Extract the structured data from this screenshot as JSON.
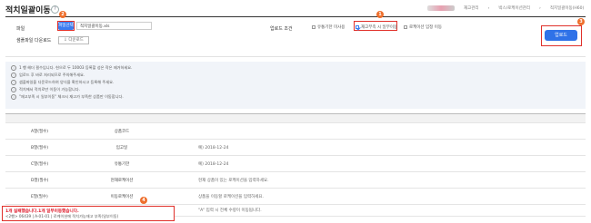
{
  "header": {
    "title": "적치일괄이동",
    "breadcrumbs": [
      "재고관리",
      "박스/로케이션관리",
      "적치일괄이동(H60)"
    ]
  },
  "form": {
    "file_label": "파일",
    "file_select_button": "파일선택",
    "file_name": "적치일괄이동.xls",
    "sample_label": "샘플파일 다운로드",
    "sample_button": "다운로드",
    "upload_condition_label": "업로드 조건",
    "options": [
      {
        "label": "유통기한 미사용",
        "checked": false
      },
      {
        "label": "재고부족 시 일부이동",
        "checked": true
      },
      {
        "label": "로케이션 임정 이동",
        "checked": false
      }
    ],
    "upload_button": "업로드"
  },
  "badges": [
    "1",
    "2",
    "3",
    "4"
  ],
  "notes": [
    "1 행 헤더 필수입니다. 헌으로 두 10003 등록할 성은 작은 제거하세요.",
    "업로드 후 바로 처리되므로 주의해주세요.",
    "샘플파일을 다운로드하여 양식을 확인하시고 등록해 주세요.",
    "적치에서 적치로만 이동이 가능합니다.",
    "\"재고부족 시 일부이동\" 체크시 재고가 부족한 상품만 이동합니다."
  ],
  "table": {
    "rows": [
      {
        "col": "A열(필수)",
        "name": "상품코드",
        "desc": ""
      },
      {
        "col": "B열(필수)",
        "name": "입고일",
        "desc": "예) 2018-12-24"
      },
      {
        "col": "C열(필수)",
        "name": "유통기한",
        "desc": "예) 2018-12-24"
      },
      {
        "col": "D열(필수)",
        "name": "현재로케이션",
        "desc": "현재 상품이 있는 로케이션을 입력하세요."
      },
      {
        "col": "E열(필수)",
        "name": "이동로케이션",
        "desc": "상품을 이동할 로케이션을 입력하세요."
      },
      {
        "col": "F열(필수)",
        "name": "수량",
        "desc": "\"A\" 입력 시 전체 수량이 이동됩니다."
      }
    ]
  },
  "result": {
    "line1": "1개 실패했습니다.1개 일부이동했습니다.",
    "line2": "<2행> 06439 | A-01-01 | 로케이션에 적치가능재고 부족(일부이동)"
  },
  "colors": {
    "accent": "#3b7cf0",
    "highlight": "#e0302a",
    "badge": "#ee6f2d"
  }
}
